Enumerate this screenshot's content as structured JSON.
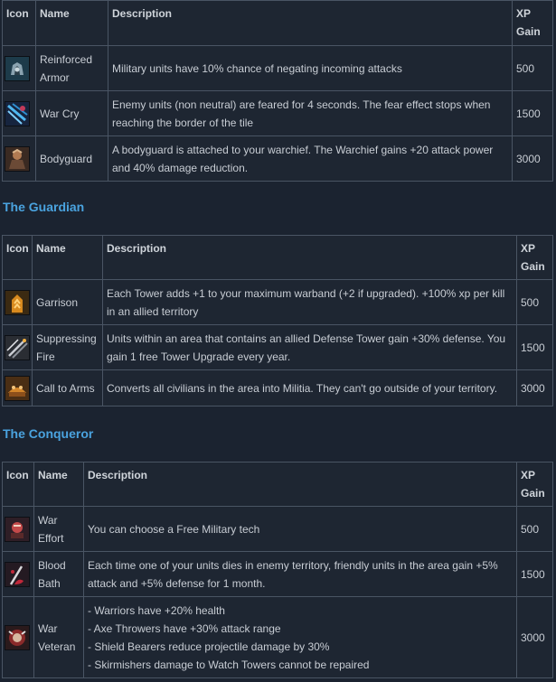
{
  "headers": {
    "icon": "Icon",
    "name": "Name",
    "description": "Description",
    "xp": "XP Gain"
  },
  "warchief": {
    "rows": [
      {
        "icon": "reinforced-armor-icon",
        "name": "Reinforced Armor",
        "description": "Military units have 10% chance of negating incoming attacks",
        "xp": "500"
      },
      {
        "icon": "war-cry-icon",
        "name": "War Cry",
        "description": "Enemy units (non neutral) are feared for 4 seconds. The fear effect stops when reaching the border of the tile",
        "xp": "1500"
      },
      {
        "icon": "bodyguard-icon",
        "name": "Bodyguard",
        "description": "A bodyguard is attached to your warchief. The Warchief gains +20 attack power and 40% damage reduction.",
        "xp": "3000"
      }
    ]
  },
  "guardian": {
    "title": "The Guardian",
    "rows": [
      {
        "icon": "garrison-icon",
        "name": "Garrison",
        "description": "Each Tower adds +1 to your maximum warband (+2 if upgraded). +100% xp per kill in an allied territory",
        "xp": "500"
      },
      {
        "icon": "suppressing-fire-icon",
        "name": "Suppressing Fire",
        "description": "Units within an area that contains an allied Defense Tower gain +30% defense. You gain 1 free Tower Upgrade every year.",
        "xp": "1500"
      },
      {
        "icon": "call-to-arms-icon",
        "name": "Call to Arms",
        "description": "Converts all civilians in the area into Militia. They can't go outside of your territory.",
        "xp": "3000"
      }
    ]
  },
  "conqueror": {
    "title": "The Conqueror",
    "rows": [
      {
        "icon": "war-effort-icon",
        "name": "War Effort",
        "description": "You can choose a Free Military tech",
        "xp": "500"
      },
      {
        "icon": "blood-bath-icon",
        "name": "Blood Bath",
        "description": "Each time one of your units dies in enemy territory, friendly units in the area gain +5% attack and +5% defense for 1 month.",
        "xp": "1500"
      },
      {
        "icon": "war-veteran-icon",
        "name": "War Veteran",
        "description_lines": [
          "- Warriors have +20% health",
          "- Axe Throwers have +30% attack range",
          "- Shield Bearers reduce projectile damage by 30%",
          "- Skirmishers damage to Watch Towers cannot be repaired"
        ],
        "xp": "3000"
      }
    ]
  },
  "colors": {
    "section_title": "#4aa3df",
    "border": "#4a5564",
    "background": "#1b2330"
  }
}
